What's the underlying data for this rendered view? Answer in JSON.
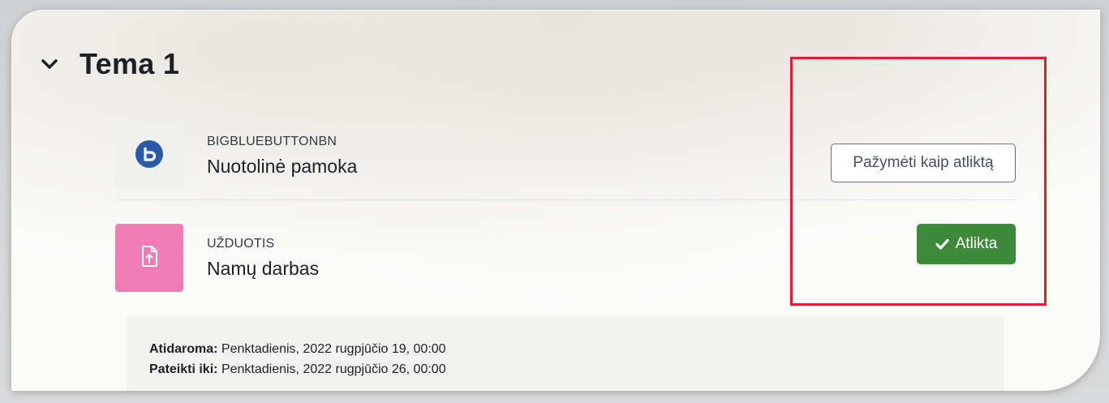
{
  "section": {
    "title": "Tema 1",
    "chevron_icon": "chevron-down-icon"
  },
  "activities": [
    {
      "type": "BIGBLUEBUTTONBN",
      "name": "Nuotolinė pamoka",
      "icon": "bigbluebutton-icon",
      "icon_color": "#2a5aa8",
      "completion": {
        "label": "Pažymėti kaip atliktą",
        "state": "not-completed"
      }
    },
    {
      "type": "UŽDUOTIS",
      "name": "Namų darbas",
      "icon": "assignment-upload-icon",
      "icon_bg": "#ef7cb6",
      "completion": {
        "label": "Atlikta",
        "state": "completed",
        "icon": "check-icon",
        "color": "#3d8a3a"
      }
    }
  ],
  "dates": {
    "opens_label": "Atidaroma:",
    "opens_value": "Penktadienis, 2022 rugpjūčio 19, 00:00",
    "due_label": "Pateikti iki:",
    "due_value": "Penktadienis, 2022 rugpjūčio 26, 00:00"
  },
  "annotation": {
    "highlight_color": "#d8232a"
  }
}
